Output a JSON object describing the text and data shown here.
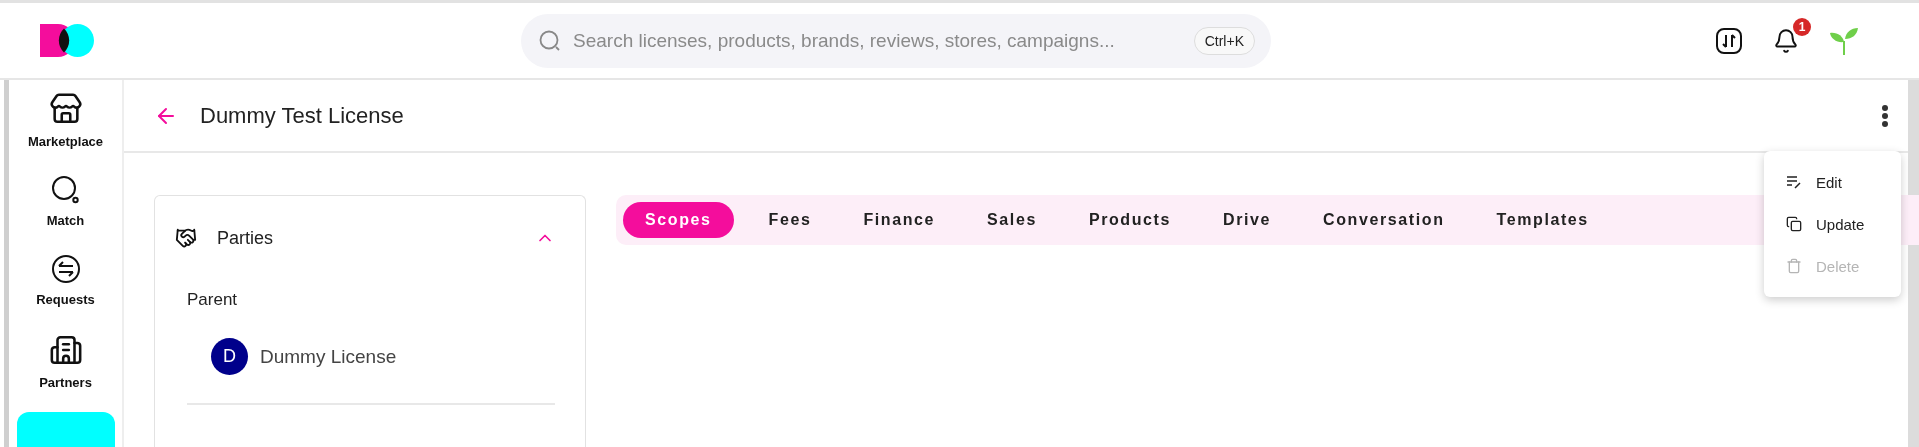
{
  "header": {
    "search": {
      "placeholder": "Search licenses, products, brands, reviews, stores, campaigns...",
      "shortcut": "Ctrl+K"
    },
    "notifications": {
      "count": "1"
    }
  },
  "sidebar": {
    "items": [
      {
        "label": "Marketplace",
        "selected": false
      },
      {
        "label": "Match",
        "selected": false
      },
      {
        "label": "Requests",
        "selected": false
      },
      {
        "label": "Partners",
        "selected": false
      },
      {
        "selected": true
      }
    ]
  },
  "page": {
    "title": "Dummy Test License"
  },
  "parties_card": {
    "title": "Parties",
    "expanded": true,
    "sections": [
      {
        "heading": "Parent",
        "entries": [
          {
            "initial": "D",
            "name": "Dummy License"
          }
        ]
      }
    ]
  },
  "tabs": [
    {
      "label": "Scopes",
      "selected": true
    },
    {
      "label": "Fees",
      "selected": false
    },
    {
      "label": "Finance",
      "selected": false
    },
    {
      "label": "Sales",
      "selected": false
    },
    {
      "label": "Products",
      "selected": false
    },
    {
      "label": "Drive",
      "selected": false
    },
    {
      "label": "Conversation",
      "selected": false
    },
    {
      "label": "Templates",
      "selected": false
    }
  ],
  "menu": {
    "items": [
      {
        "label": "Edit",
        "disabled": false
      },
      {
        "label": "Update",
        "disabled": false
      },
      {
        "label": "Delete",
        "disabled": true
      }
    ]
  }
}
